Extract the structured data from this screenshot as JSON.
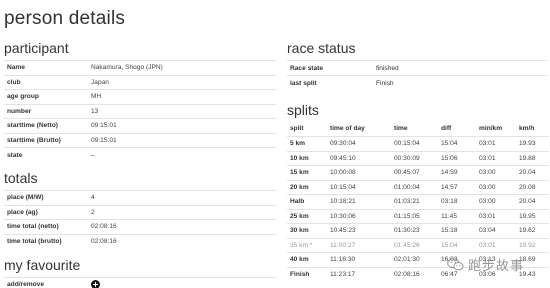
{
  "page": {
    "title": "person details"
  },
  "participant": {
    "heading": "participant",
    "rows": [
      {
        "label": "Name",
        "value": "Nakamura, Shogo (JPN)"
      },
      {
        "label": "club",
        "value": "Japan"
      },
      {
        "label": "age group",
        "value": "MH"
      },
      {
        "label": "number",
        "value": "13"
      },
      {
        "label": "starttime (Netto)",
        "value": "09:15:01"
      },
      {
        "label": "starttime (Brutto)",
        "value": "09:15:01"
      },
      {
        "label": "state",
        "value": "–"
      }
    ]
  },
  "totals": {
    "heading": "totals",
    "rows": [
      {
        "label": "place (M/W)",
        "value": "4"
      },
      {
        "label": "place (ag)",
        "value": "2"
      },
      {
        "label": "time total (netto)",
        "value": "02:08:16"
      },
      {
        "label": "time total (brutto)",
        "value": "02:08:16"
      }
    ]
  },
  "favourite": {
    "heading": "my favourite",
    "label": "add/remove",
    "button_icon": "plus-circle-icon"
  },
  "race_status": {
    "heading": "race status",
    "rows": [
      {
        "label": "Race state",
        "value": "finished"
      },
      {
        "label": "last split",
        "value": "Finish"
      }
    ]
  },
  "splits": {
    "heading": "splits",
    "columns": [
      "split",
      "time of day",
      "time",
      "diff",
      "min/km",
      "km/h"
    ],
    "rows": [
      [
        "5 km",
        "09:30:04",
        "00:15:04",
        "15:04",
        "03:01",
        "19.93"
      ],
      [
        "10 km",
        "09:45:10",
        "00:30:09",
        "15:06",
        "03:01",
        "19.88"
      ],
      [
        "15 km",
        "10:00:08",
        "00:45:07",
        "14:59",
        "03:00",
        "20.04"
      ],
      [
        "20 km",
        "10:15:04",
        "01:00:04",
        "14:57",
        "03:00",
        "20.08"
      ],
      [
        "Halb",
        "10:18:21",
        "01:03:21",
        "03:18",
        "03:00",
        "20.04"
      ],
      [
        "25 km",
        "10:30:06",
        "01:15:05",
        "11:45",
        "03:01",
        "19.95"
      ],
      [
        "30 km",
        "10:45:23",
        "01:30:23",
        "15:18",
        "03:04",
        "19.62"
      ],
      [
        "35 km *",
        "11:00:27",
        "01:45:26",
        "15:04",
        "03:01",
        "19.92"
      ],
      [
        "40 km",
        "11:16:30",
        "02:01:30",
        "16:03",
        "03:13",
        "18.69"
      ],
      [
        "Finish",
        "11:23:17",
        "02:08:16",
        "06:47",
        "03:06",
        "19.43"
      ]
    ],
    "muted_rows": [
      7
    ]
  },
  "watermark": {
    "text": "跑步故事",
    "icon": "wechat-icon"
  }
}
